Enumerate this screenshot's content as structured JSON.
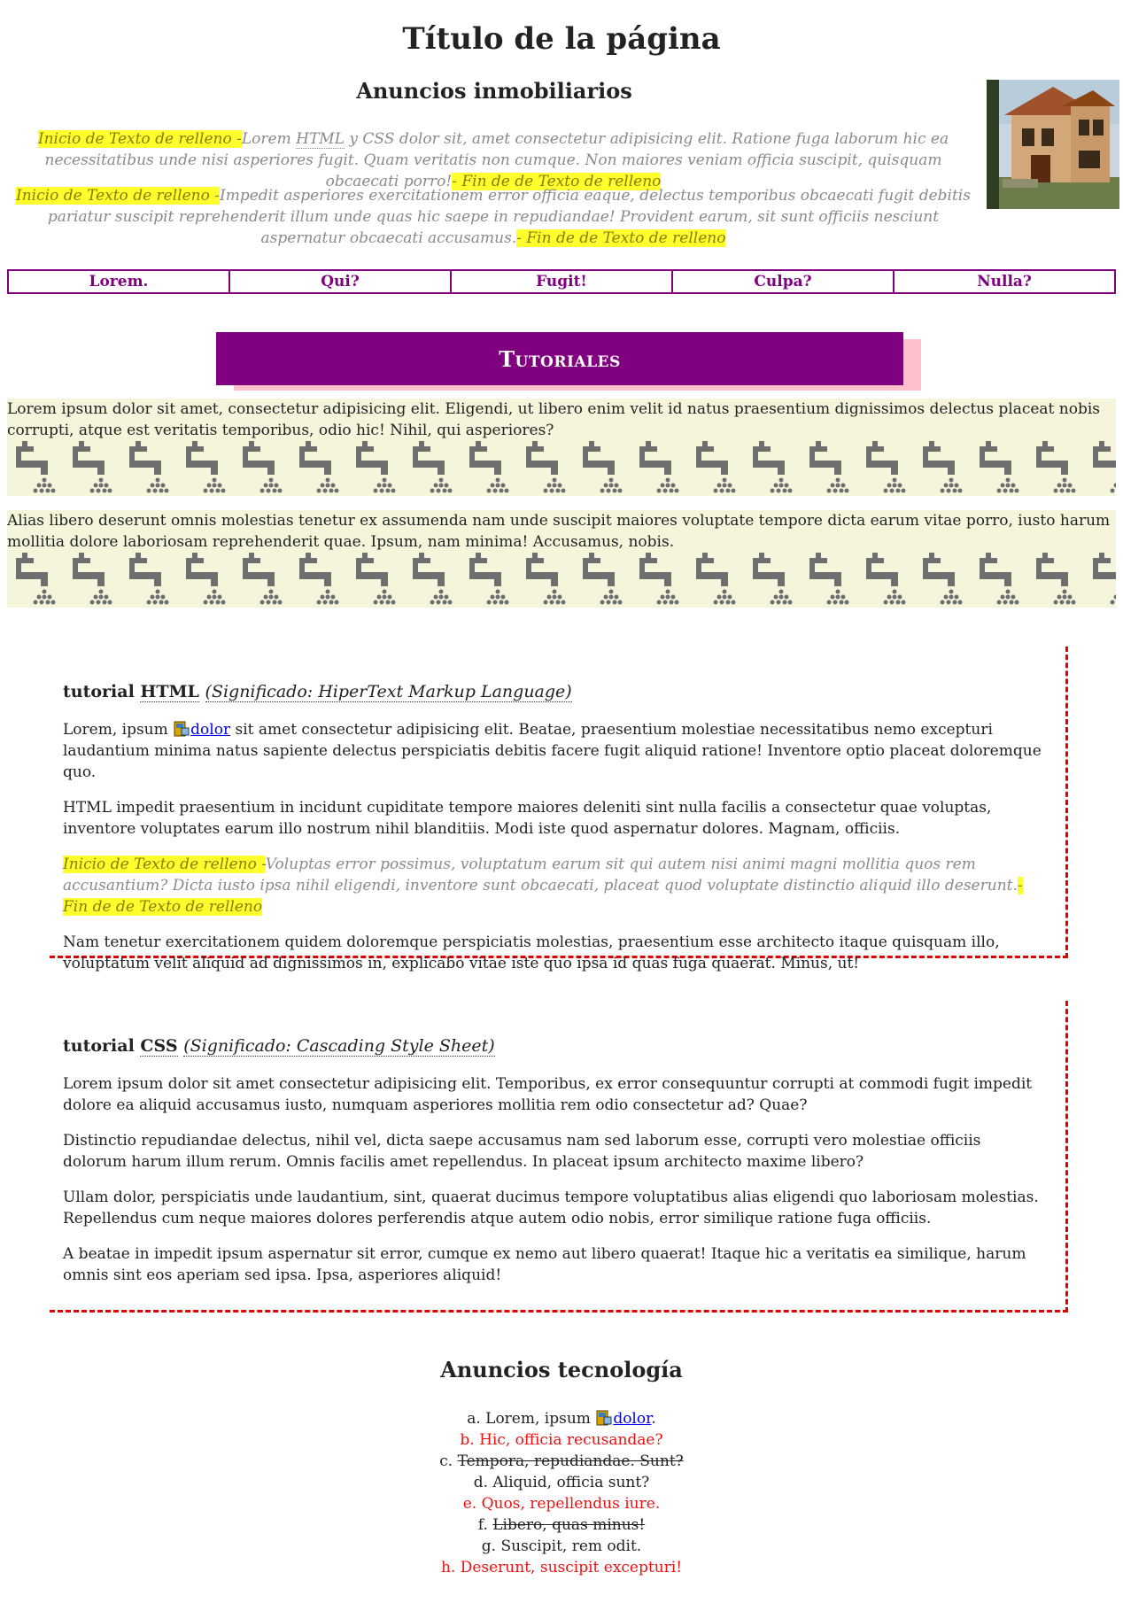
{
  "page_title": "Título de la página",
  "real_estate": {
    "heading": "Anuncios inmobiliarios",
    "image_alt": "Casa",
    "filler_start": "Inicio de Texto de relleno -",
    "filler_end": "- Fin de de Texto de relleno",
    "para1_pre": "Lorem ",
    "para1_abbr": "HTML",
    "para1_post": " y CSS dolor sit, amet consectetur adipisicing elit. Ratione fuga laborum hic ea necessitatibus unde nisi asperiores fugit. Quam veritatis non cumque. Non maiores veniam officia suscipit, quisquam obcaecati porro!",
    "para2": "Impedit asperiores exercitationem error officia eaque, delectus temporibus obcaecati fugit debitis pariatur suscipit reprehenderit illum unde quas hic saepe in repudiandae! Provident earum, sit sunt officiis nesciunt aspernatur obcaecati accusamus."
  },
  "nav": [
    "Lorem.",
    "Qui?",
    "Fugit!",
    "Culpa?",
    "Nulla?"
  ],
  "tutorials_banner": "Tutoriales",
  "beige_blocks": [
    "Lorem ipsum dolor sit amet, consectetur adipisicing elit. Eligendi, ut libero enim velit id natus praesentium dignissimos delectus placeat nobis corrupti, atque est veritatis temporibus, odio hic! Nihil, qui asperiores?",
    "Alias libero deserunt omnis molestias tenetur ex assumenda nam unde suscipit maiores voluptate tempore dicta earum vitae porro, iusto harum mollitia dolore laboriosam reprehenderit quae. Ipsum, nam minima! Accusamus, nobis."
  ],
  "html_tutorial": {
    "prefix": "tutorial ",
    "abbr": "HTML",
    "meaning": "(Significado: HiperText Markup Language)",
    "p1_pre": "Lorem, ipsum ",
    "p1_link": "dolor",
    "p1_post": " sit amet consectetur adipisicing elit. Beatae, praesentium molestiae necessitatibus nemo excepturi laudantium minima natus sapiente delectus perspiciatis debitis facere fugit aliquid ratione! Inventore optio placeat doloremque quo.",
    "p2": "HTML impedit praesentium in incidunt cupiditate tempore maiores deleniti sint nulla facilis a consectetur quae voluptas, inventore voluptates earum illo nostrum nihil blanditiis. Modi iste quod aspernatur dolores. Magnam, officiis.",
    "p3_start": "Inicio de Texto de relleno -",
    "p3": "Voluptas error possimus, voluptatum earum sit qui autem nisi animi magni mollitia quos rem accusantium? Dicta iusto ipsa nihil eligendi, inventore sunt obcaecati, placeat quod voluptate distinctio aliquid illo deserunt.",
    "p3_end": "- Fin de de Texto de relleno",
    "p4": "Nam tenetur exercitationem quidem doloremque perspiciatis molestias, praesentium esse architecto itaque quisquam illo, voluptatum velit aliquid ad dignissimos in, explicabo vitae iste quo ipsa id quas fuga quaerat. Minus, ut!"
  },
  "css_tutorial": {
    "prefix": "tutorial ",
    "abbr": "CSS",
    "meaning": "(Significado: Cascading Style Sheet)",
    "p1": "Lorem ipsum dolor sit amet consectetur adipisicing elit. Temporibus, ex error consequuntur corrupti at commodi fugit impedit dolore ea aliquid accusamus iusto, numquam asperiores mollitia rem odio consectetur ad? Quae?",
    "p2": "Distinctio repudiandae delectus, nihil vel, dicta saepe accusamus nam sed laborum esse, corrupti vero molestiae officiis dolorum harum illum rerum. Omnis facilis amet repellendus. In placeat ipsum architecto maxime libero?",
    "p3": "Ullam dolor, perspiciatis unde laudantium, sint, quaerat ducimus tempore voluptatibus alias eligendi quo laboriosam molestias. Repellendus cum neque maiores dolores perferendis atque autem odio nobis, error similique ratione fuga officiis.",
    "p4": "A beatae in impedit ipsum aspernatur sit error, cumque ex nemo aut libero quaerat! Itaque hic a veritatis ea similique, harum omnis sint eos aperiam sed ipsa. Ipsa, asperiores aliquid!"
  },
  "tech": {
    "heading": "Anuncios tecnología",
    "items": {
      "a_marker": "a. ",
      "a_pre": "Lorem, ipsum ",
      "a_link": "dolor",
      "a_post": ".",
      "b": "b. Hic, officia recusandae?",
      "c_marker": "c. ",
      "c": "Tempora, repudiandae. Sunt?",
      "d": "d. Aliquid, officia sunt?",
      "e": "e. Quos, repellendus iure.",
      "f_marker": "f. ",
      "f": "Libero, quas minus!",
      "g": "g. Suscipit, rem odit.",
      "h": "h. Deserunt, suscipit excepturi!"
    }
  },
  "colors": {
    "accent": "#800080",
    "highlight": "#ffff2e",
    "beige": "#f5f5dc",
    "dashed_border": "#e00000",
    "red_text": "#ee1111",
    "shadow": "#ffc0cb"
  },
  "icons": {
    "tap": "faucet-icon",
    "inline": "book-computer-icon",
    "house": "house-photo"
  }
}
